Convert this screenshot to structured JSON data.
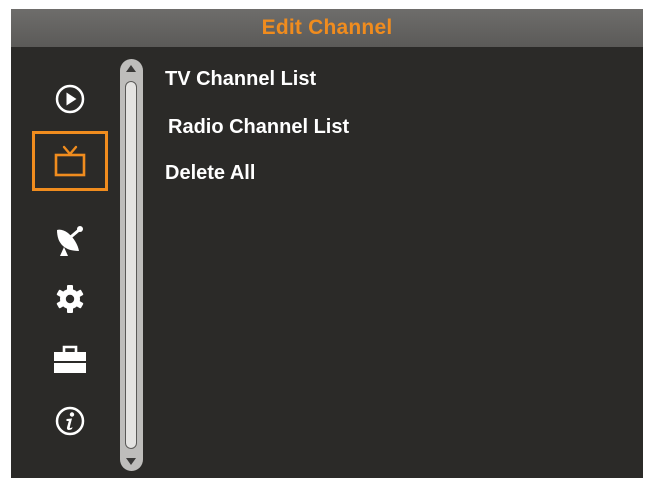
{
  "header": {
    "title": "Edit Channel",
    "title_color": "#f08c1e"
  },
  "sidebar": {
    "selected_index": 1,
    "items": [
      {
        "icon": "play-icon"
      },
      {
        "icon": "tv-icon"
      },
      {
        "icon": "satellite-dish-icon"
      },
      {
        "icon": "gear-icon"
      },
      {
        "icon": "toolbox-icon"
      },
      {
        "icon": "info-icon"
      }
    ]
  },
  "menu": {
    "items": [
      {
        "label": "TV Channel List"
      },
      {
        "label": "Radio Channel List"
      },
      {
        "label": "Delete All"
      }
    ]
  },
  "colors": {
    "background": "#2b2a28",
    "header": "#676664",
    "accent": "#f08c1e",
    "text": "#ffffff",
    "scrollbar": "#bebdbb"
  }
}
